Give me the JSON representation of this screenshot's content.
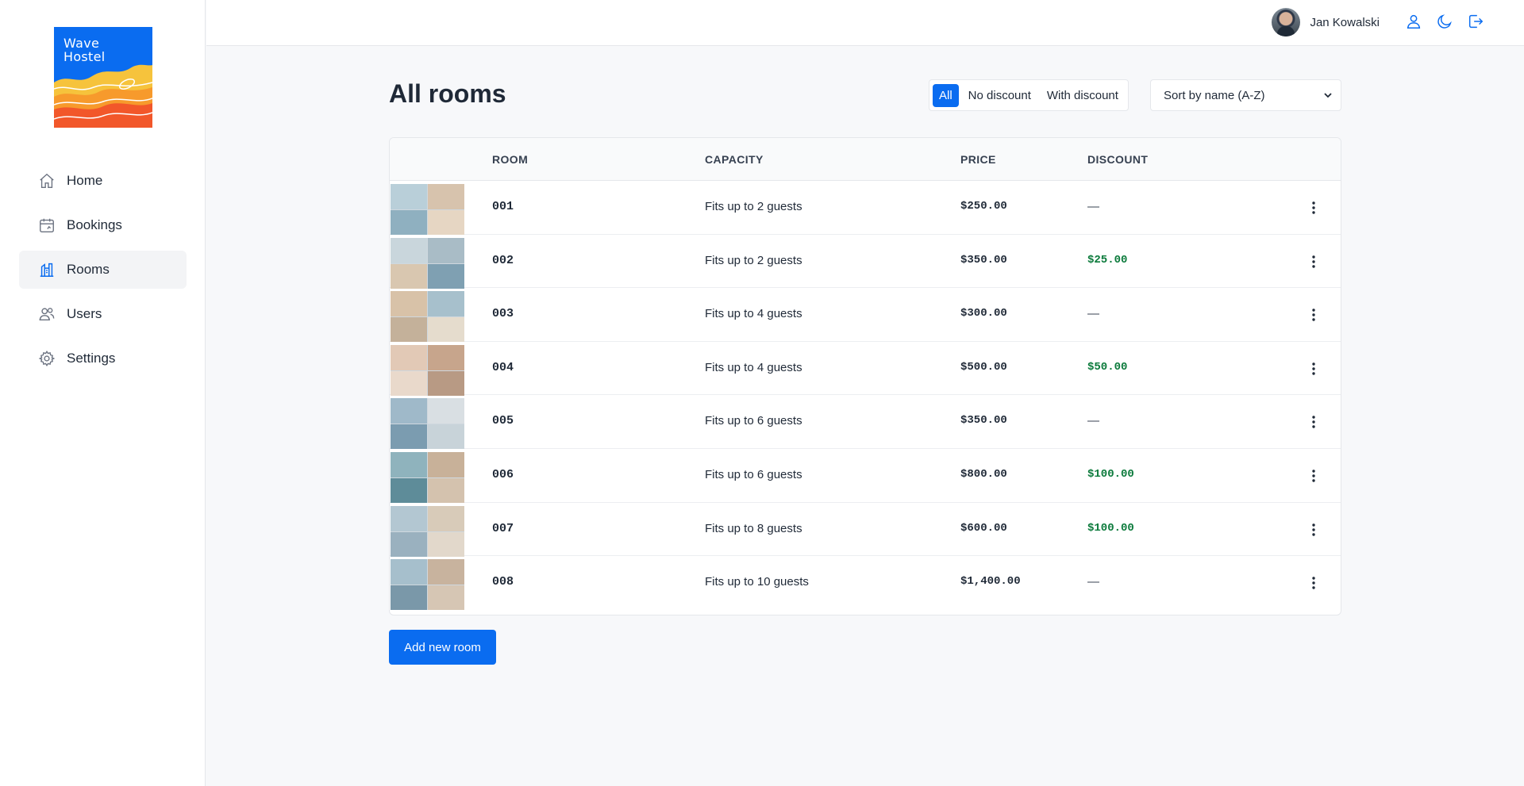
{
  "brand": {
    "name_line1": "Wave",
    "name_line2": "Hostel"
  },
  "sidebar": {
    "items": [
      {
        "label": "Home",
        "icon": "home-icon",
        "active": false
      },
      {
        "label": "Bookings",
        "icon": "calendar-icon",
        "active": false
      },
      {
        "label": "Rooms",
        "icon": "building-icon",
        "active": true
      },
      {
        "label": "Users",
        "icon": "users-icon",
        "active": false
      },
      {
        "label": "Settings",
        "icon": "gear-icon",
        "active": false
      }
    ]
  },
  "header": {
    "user_name": "Jan Kowalski",
    "icons": [
      "user-icon",
      "moon-icon",
      "logout-icon"
    ]
  },
  "main": {
    "title": "All rooms",
    "filters": [
      "All",
      "No discount",
      "With discount"
    ],
    "active_filter": "All",
    "sort": {
      "selected": "Sort by name (A-Z)"
    },
    "table": {
      "columns": [
        "ROOM",
        "CAPACITY",
        "PRICE",
        "DISCOUNT"
      ],
      "rows": [
        {
          "room": "001",
          "capacity": "Fits up to 2 guests",
          "price": "$250.00",
          "discount": "—"
        },
        {
          "room": "002",
          "capacity": "Fits up to 2 guests",
          "price": "$350.00",
          "discount": "$25.00"
        },
        {
          "room": "003",
          "capacity": "Fits up to 4 guests",
          "price": "$300.00",
          "discount": "—"
        },
        {
          "room": "004",
          "capacity": "Fits up to 4 guests",
          "price": "$500.00",
          "discount": "$50.00"
        },
        {
          "room": "005",
          "capacity": "Fits up to 6 guests",
          "price": "$350.00",
          "discount": "—"
        },
        {
          "room": "006",
          "capacity": "Fits up to 6 guests",
          "price": "$800.00",
          "discount": "$100.00"
        },
        {
          "room": "007",
          "capacity": "Fits up to 8 guests",
          "price": "$600.00",
          "discount": "$100.00"
        },
        {
          "room": "008",
          "capacity": "Fits up to 10 guests",
          "price": "$1,400.00",
          "discount": "—"
        }
      ]
    },
    "add_button": "Add new room"
  },
  "colors": {
    "accent": "#0a6cf0",
    "discount": "#0b7a3b"
  }
}
